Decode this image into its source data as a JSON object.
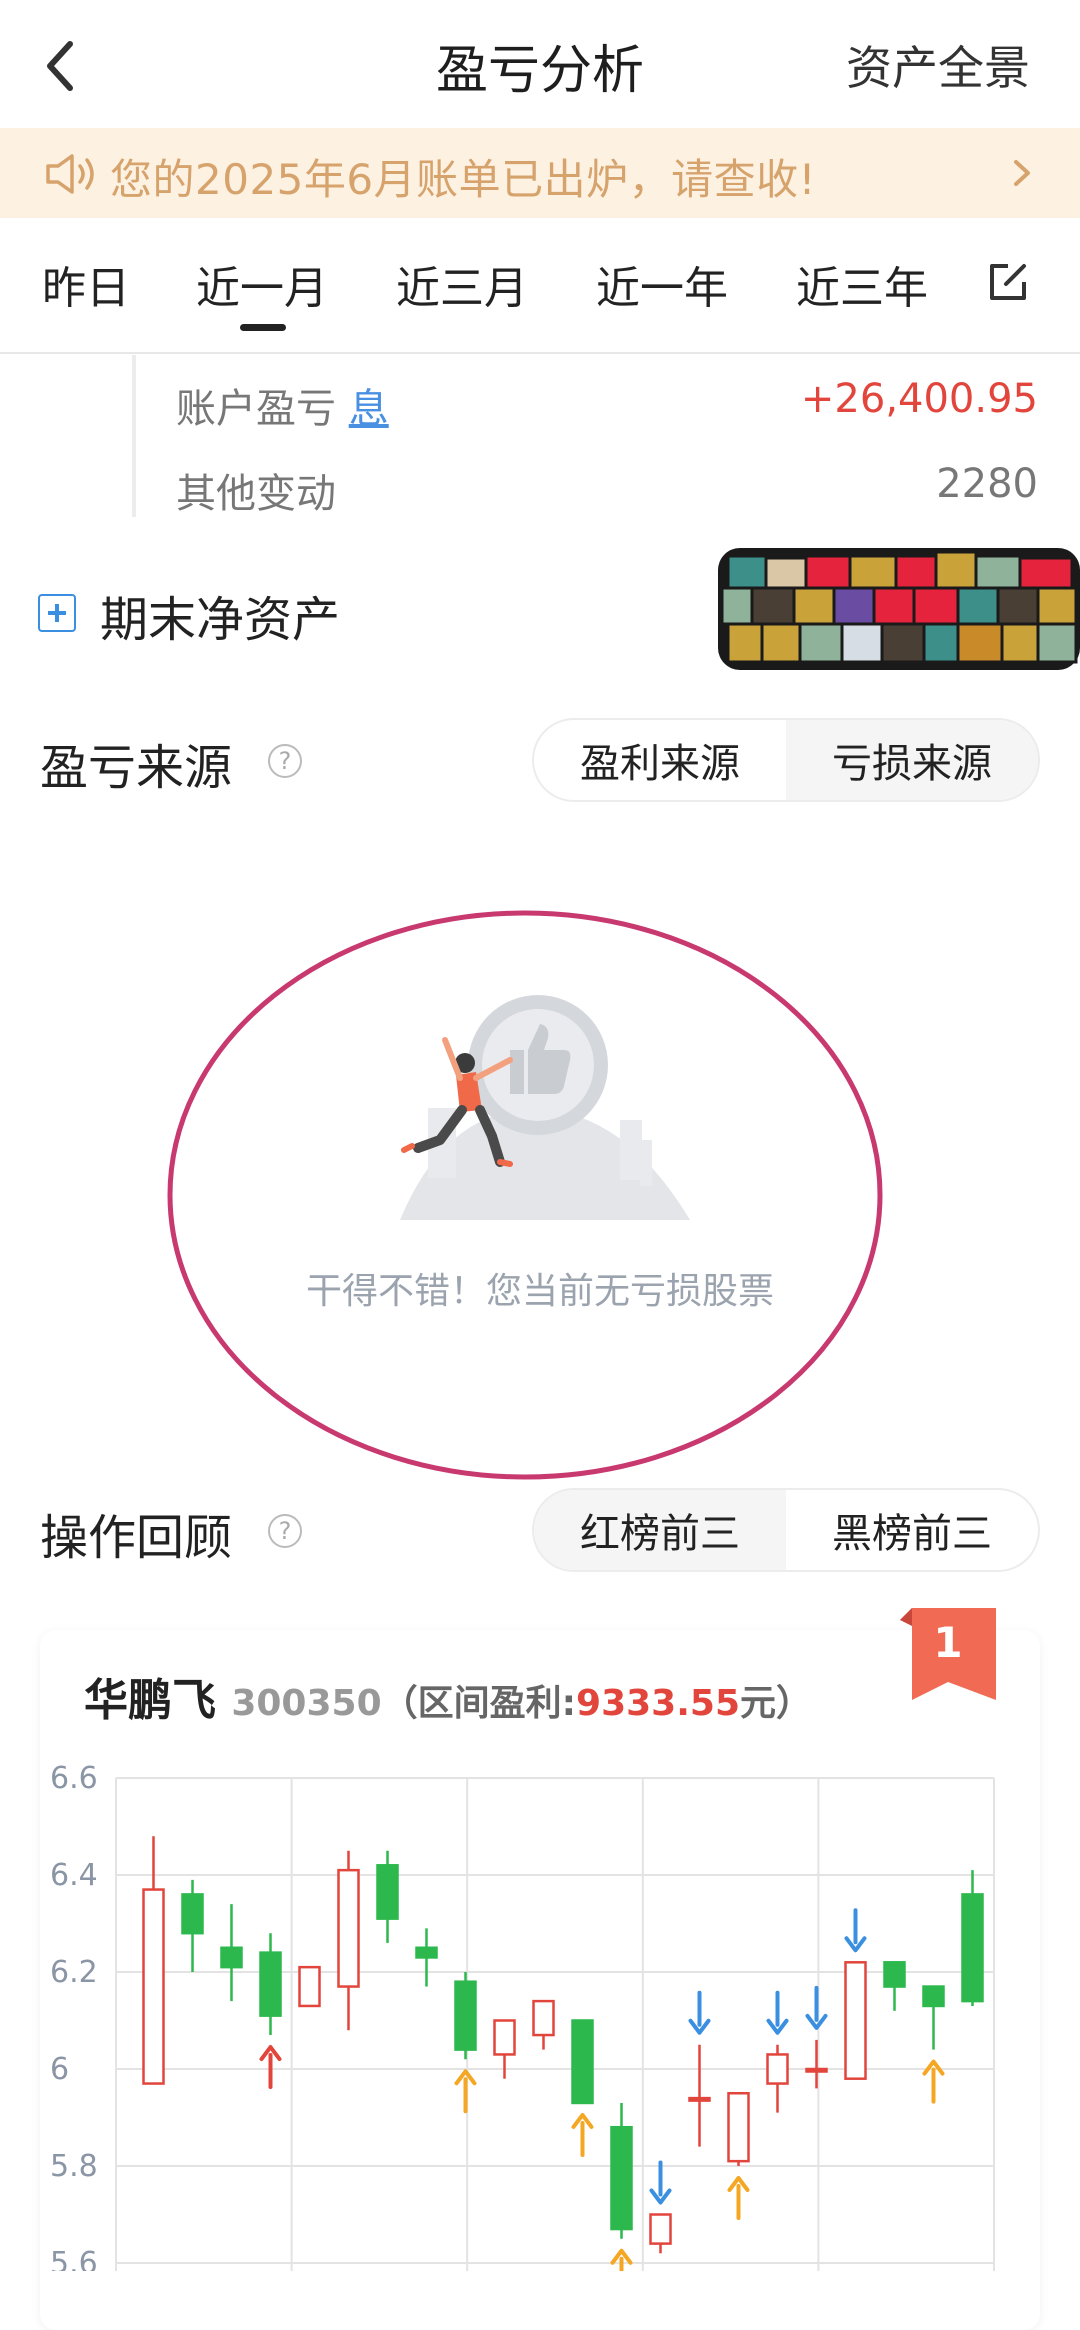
{
  "header": {
    "title": "盈亏分析",
    "right_link": "资产全景"
  },
  "notice": {
    "text": "您的2025年6月账单已出炉，请查收!"
  },
  "tabs": [
    {
      "label": "昨日"
    },
    {
      "label": "近一月",
      "active": true
    },
    {
      "label": "近三月"
    },
    {
      "label": "近一年"
    },
    {
      "label": "近三年"
    }
  ],
  "summary": {
    "account_pnl_label": "账户盈亏",
    "account_pnl_info": "息",
    "account_pnl_value": "+26,400.95",
    "other_change_label": "其他变动",
    "other_change_value": "2280"
  },
  "net_assets": {
    "label": "期末净资产"
  },
  "pnl_source": {
    "title": "盈亏来源",
    "profit_tab": "盈利来源",
    "loss_tab": "亏损来源",
    "empty_text": "干得不错！您当前无亏损股票"
  },
  "review": {
    "title": "操作回顾",
    "red_tab": "红榜前三",
    "black_tab": "黑榜前三"
  },
  "stock_card": {
    "rank": "1",
    "name": "华鹏飞",
    "code": "300350",
    "profit_prefix": "（区间盈利:",
    "profit_value": "9333.55",
    "profit_suffix": "元）"
  },
  "colors": {
    "up": "#e2453c",
    "down": "#2db84d",
    "accent_blue": "#3a8fe0",
    "notice_text": "#d6a36d",
    "ellipse": "#c8396f",
    "sell_arrow": "#3a8fe0",
    "buy_arrow": "#f5a623"
  },
  "chart_data": {
    "type": "candlestick",
    "ylim": [
      5.55,
      6.65
    ],
    "yticks": [
      "6.6",
      "6.4",
      "6.2",
      "6",
      "5.8",
      "5.6"
    ],
    "ytick_values": [
      6.6,
      6.4,
      6.2,
      6.0,
      5.8,
      5.6
    ],
    "candles": [
      {
        "o": 5.97,
        "c": 6.37,
        "h": 6.48,
        "l": 5.97
      },
      {
        "o": 6.36,
        "c": 6.28,
        "h": 6.39,
        "l": 6.2
      },
      {
        "o": 6.25,
        "c": 6.21,
        "h": 6.34,
        "l": 6.14
      },
      {
        "o": 6.24,
        "c": 6.11,
        "h": 6.28,
        "l": 6.07
      },
      {
        "o": 6.13,
        "c": 6.21,
        "h": 6.21,
        "l": 6.13
      },
      {
        "o": 6.17,
        "c": 6.41,
        "h": 6.45,
        "l": 6.08
      },
      {
        "o": 6.42,
        "c": 6.31,
        "h": 6.45,
        "l": 6.26
      },
      {
        "o": 6.25,
        "c": 6.23,
        "h": 6.29,
        "l": 6.17
      },
      {
        "o": 6.18,
        "c": 6.04,
        "h": 6.2,
        "l": 6.02
      },
      {
        "o": 6.03,
        "c": 6.1,
        "h": 6.1,
        "l": 5.98
      },
      {
        "o": 6.07,
        "c": 6.14,
        "h": 6.14,
        "l": 6.04
      },
      {
        "o": 6.1,
        "c": 5.93,
        "h": 6.1,
        "l": 5.93
      },
      {
        "o": 5.88,
        "c": 5.67,
        "h": 5.93,
        "l": 5.65
      },
      {
        "o": 5.64,
        "c": 5.7,
        "h": 5.7,
        "l": 5.62
      },
      {
        "o": 5.94,
        "c": 5.94,
        "h": 6.05,
        "l": 5.84
      },
      {
        "o": 5.81,
        "c": 5.95,
        "h": 5.95,
        "l": 5.8
      },
      {
        "o": 5.97,
        "c": 6.03,
        "h": 6.05,
        "l": 5.91
      },
      {
        "o": 6.0,
        "c": 6.0,
        "h": 6.06,
        "l": 5.96
      },
      {
        "o": 5.98,
        "c": 6.22,
        "h": 6.22,
        "l": 5.98
      },
      {
        "o": 6.22,
        "c": 6.17,
        "h": 6.22,
        "l": 6.12
      },
      {
        "o": 6.17,
        "c": 6.13,
        "h": 6.17,
        "l": 6.04
      },
      {
        "o": 6.36,
        "c": 6.14,
        "h": 6.41,
        "l": 6.13
      }
    ],
    "markers": [
      {
        "i": 3,
        "type": "buy-red"
      },
      {
        "i": 8,
        "type": "buy"
      },
      {
        "i": 11,
        "type": "buy"
      },
      {
        "i": 12,
        "type": "buy"
      },
      {
        "i": 13,
        "type": "sell"
      },
      {
        "i": 14,
        "type": "sell"
      },
      {
        "i": 15,
        "type": "buy"
      },
      {
        "i": 16,
        "type": "sell"
      },
      {
        "i": 17,
        "type": "sell"
      },
      {
        "i": 18,
        "type": "sell"
      },
      {
        "i": 20,
        "type": "buy"
      }
    ],
    "grid": true
  }
}
